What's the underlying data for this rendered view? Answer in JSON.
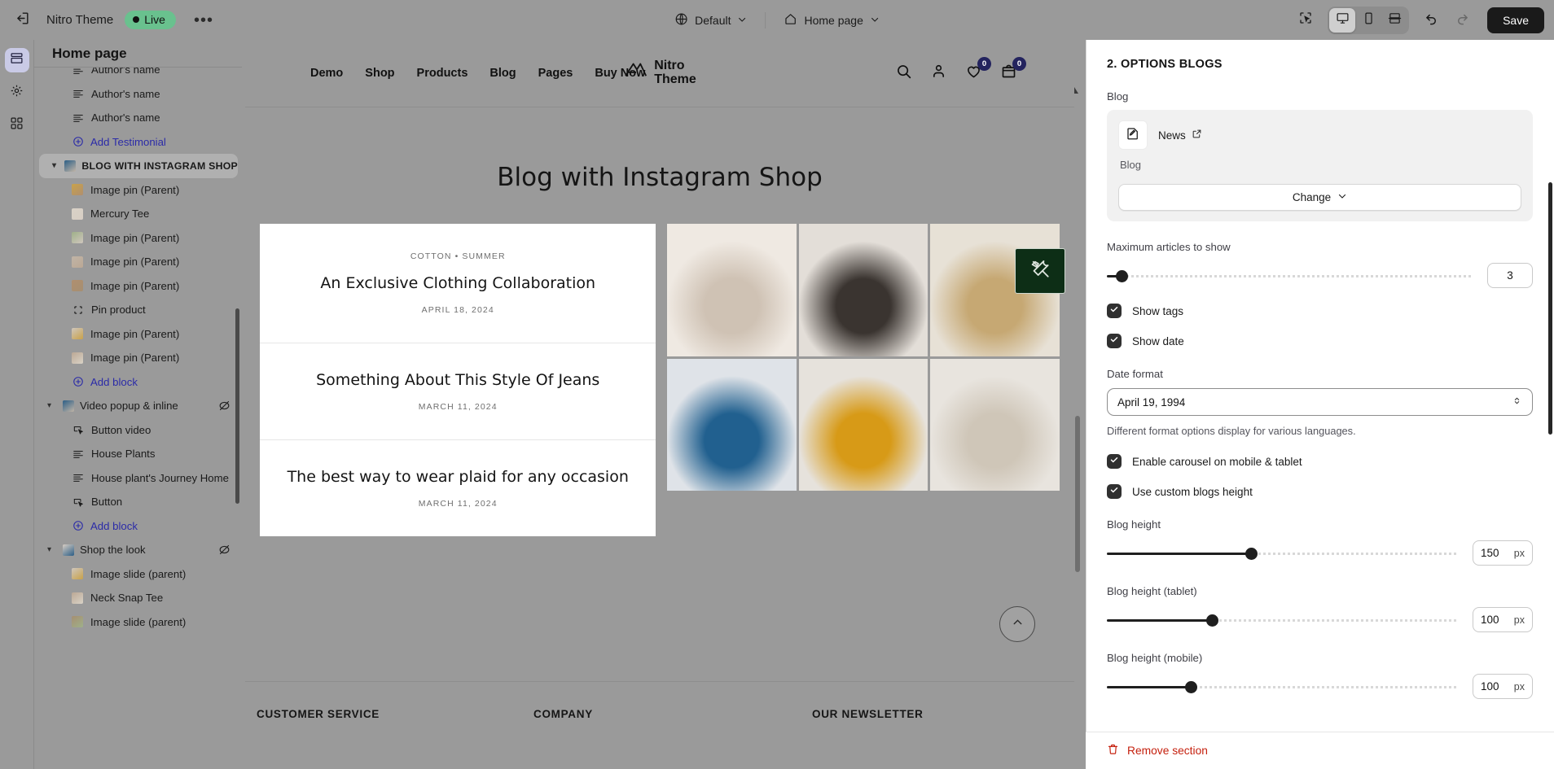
{
  "topbar": {
    "back_icon": "exit-icon",
    "theme_name": "Nitro Theme",
    "status_label": "Live",
    "more_label": "•••",
    "locale_icon": "globe-icon",
    "locale_label": "Default",
    "page_icon": "home-icon",
    "page_label": "Home page",
    "inspect_icon": "inspector-icon",
    "desktop_icon": "desktop-icon",
    "mobile_icon": "mobile-icon",
    "fullwidth_icon": "full-width-icon",
    "undo_icon": "undo-icon",
    "redo_icon": "redo-icon",
    "save_label": "Save"
  },
  "rail": {
    "items": [
      {
        "name": "sections-icon"
      },
      {
        "name": "settings-icon"
      },
      {
        "name": "apps-icon"
      }
    ]
  },
  "sidebar": {
    "title": "Home page",
    "rows": [
      {
        "label": "Author's name",
        "type": "block",
        "icon": "text-icon",
        "clipped": true
      },
      {
        "label": "Author's name",
        "type": "block",
        "icon": "text-icon"
      },
      {
        "label": "Author's name",
        "type": "block",
        "icon": "text-icon"
      },
      {
        "label": "Add Testimonial",
        "type": "add",
        "icon": "plus-circle-icon"
      },
      {
        "label": "BLOG WITH INSTAGRAM SHOP",
        "type": "section",
        "icon": "image-thumb",
        "selected": true
      },
      {
        "label": "Image pin (Parent)",
        "type": "block",
        "icon": "image-thumb"
      },
      {
        "label": "Mercury Tee",
        "type": "block",
        "icon": "image-thumb"
      },
      {
        "label": "Image pin (Parent)",
        "type": "block",
        "icon": "image-thumb"
      },
      {
        "label": "Image pin (Parent)",
        "type": "block",
        "icon": "image-thumb"
      },
      {
        "label": "Image pin (Parent)",
        "type": "block",
        "icon": "image-thumb"
      },
      {
        "label": "Pin product",
        "type": "block",
        "icon": "pin-product-icon"
      },
      {
        "label": "Image pin (Parent)",
        "type": "block",
        "icon": "image-thumb"
      },
      {
        "label": "Image pin (Parent)",
        "type": "block",
        "icon": "image-thumb"
      },
      {
        "label": "Add block",
        "type": "add",
        "icon": "plus-circle-icon"
      },
      {
        "label": "Video popup & inline",
        "type": "group",
        "icon": "image-thumb",
        "hidden_toggle": true
      },
      {
        "label": "Button video",
        "type": "block",
        "icon": "button-icon"
      },
      {
        "label": "House Plants",
        "type": "block",
        "icon": "text-icon"
      },
      {
        "label": "House plant's Journey Home",
        "type": "block",
        "icon": "text-icon"
      },
      {
        "label": "Button",
        "type": "block",
        "icon": "button-icon"
      },
      {
        "label": "Add block",
        "type": "add",
        "icon": "plus-circle-icon"
      },
      {
        "label": "Shop the look",
        "type": "group",
        "icon": "image-thumb",
        "hidden_toggle": true
      },
      {
        "label": "Image slide (parent)",
        "type": "block",
        "icon": "image-thumb"
      },
      {
        "label": "Neck Snap Tee",
        "type": "block",
        "icon": "image-thumb"
      },
      {
        "label": "Image slide (parent)",
        "type": "block",
        "icon": "image-thumb"
      }
    ]
  },
  "preview": {
    "nav": [
      "Demo",
      "Shop",
      "Products",
      "Blog",
      "Pages",
      "Buy Now"
    ],
    "logo_line1": "Nitro",
    "logo_line2": "Theme",
    "header_icons": [
      {
        "name": "search-icon",
        "badge": null
      },
      {
        "name": "account-icon",
        "badge": null
      },
      {
        "name": "wishlist-heart-icon",
        "badge": "0"
      },
      {
        "name": "cart-icon",
        "badge": "0"
      }
    ],
    "section_title": "Blog with Instagram Shop",
    "articles": [
      {
        "tags": "COTTON • SUMMER",
        "title": "An Exclusive Clothing Collaboration",
        "date": "APRIL 18, 2024"
      },
      {
        "tags": "",
        "title": "Something About This Style Of Jeans",
        "date": "MARCH 11, 2024"
      },
      {
        "tags": "",
        "title": "The best way to wear plaid for any occasion",
        "date": "MARCH 11, 2024"
      }
    ],
    "gallery": [
      {
        "name": "woman-white-shirt",
        "c1": "#efe9e2",
        "c2": "#cfc2b4"
      },
      {
        "name": "woman-black-coat",
        "c1": "#e3ded8",
        "c2": "#3a3430"
      },
      {
        "name": "woman-straw-hat",
        "c1": "#e7e1d6",
        "c2": "#c6a873"
      },
      {
        "name": "man-blue-jacket",
        "c1": "#dfe3e8",
        "c2": "#21608f"
      },
      {
        "name": "man-yellow-sweater",
        "c1": "#e6e2dc",
        "c2": "#d79a17"
      },
      {
        "name": "woman-white-bag",
        "c1": "#e8e4de",
        "c2": "#cfc6b8"
      }
    ],
    "tools_icon": "tools-icon",
    "back_to_top_icon": "chevron-up-icon",
    "footer_columns": [
      "CUSTOMER SERVICE",
      "COMPANY",
      "OUR NEWSLETTER"
    ]
  },
  "panel": {
    "title": "2. OPTIONS BLOGS",
    "blog_label": "Blog",
    "blog_card": {
      "icon": "blog-edit-icon",
      "name": "News",
      "external_icon": "external-link-icon",
      "subtitle": "Blog",
      "change_label": "Change",
      "change_icon": "chevron-down-icon"
    },
    "max_articles": {
      "label": "Maximum articles to show",
      "value": "3",
      "percent": 4
    },
    "show_tags": {
      "label": "Show tags",
      "checked": true
    },
    "show_date": {
      "label": "Show date",
      "checked": true
    },
    "date_format": {
      "label": "Date format",
      "value": "April 19, 1994",
      "hint": "Different format options display for various languages."
    },
    "enable_carousel": {
      "label": "Enable carousel on mobile & tablet",
      "checked": true
    },
    "use_custom_height": {
      "label": "Use custom blogs height",
      "checked": true
    },
    "blog_height": {
      "label": "Blog height",
      "value": "150",
      "unit": "px",
      "percent": 41
    },
    "blog_height_tablet": {
      "label": "Blog height (tablet)",
      "value": "100",
      "unit": "px",
      "percent": 30
    },
    "blog_height_mobile": {
      "label": "Blog height (mobile)",
      "value": "100",
      "unit": "px",
      "percent": 24
    },
    "remove_label": "Remove section",
    "remove_icon": "trash-icon",
    "remove_color": "#c5200e"
  }
}
